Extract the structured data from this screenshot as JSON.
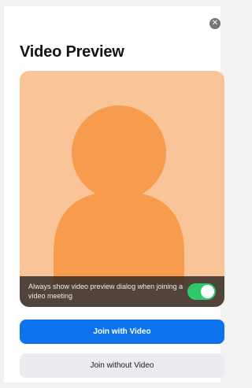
{
  "dialog": {
    "title": "Video Preview",
    "close_icon": "close-icon",
    "close_glyph": "✕"
  },
  "preview": {
    "background_color": "#f9c497",
    "avatar_color": "#f79b4c",
    "banner_text": "Always show video preview dialog when joining a video meeting",
    "toggle_state": "on",
    "toggle_color": "#2ec96b"
  },
  "buttons": {
    "join_with_video": "Join with Video",
    "join_without_video": "Join without Video",
    "primary_color": "#0e72ed"
  }
}
